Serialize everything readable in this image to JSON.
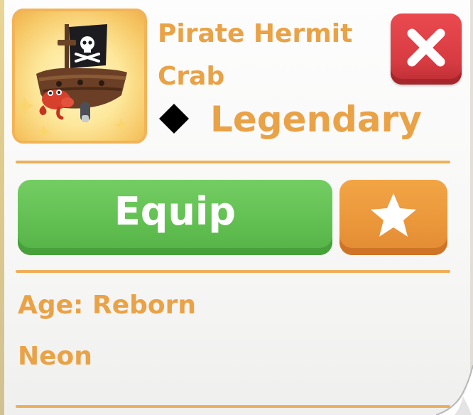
{
  "pet": {
    "name_line1": "Pirate Hermit",
    "name_line2": "Crab",
    "rarity": "Legendary"
  },
  "actions": {
    "equip_label": "Equip"
  },
  "details": {
    "age": "Age: Reborn",
    "neon": "Neon"
  },
  "icons": {
    "close": "close-x-icon",
    "favorite": "star-icon",
    "rarity": "diamond-icon"
  },
  "colors": {
    "text_orange": "#e9a246",
    "equip_green": "#62c052",
    "favorite_orange": "#ea963a",
    "close_red": "#d63b41",
    "divider": "#eeaf5a"
  }
}
